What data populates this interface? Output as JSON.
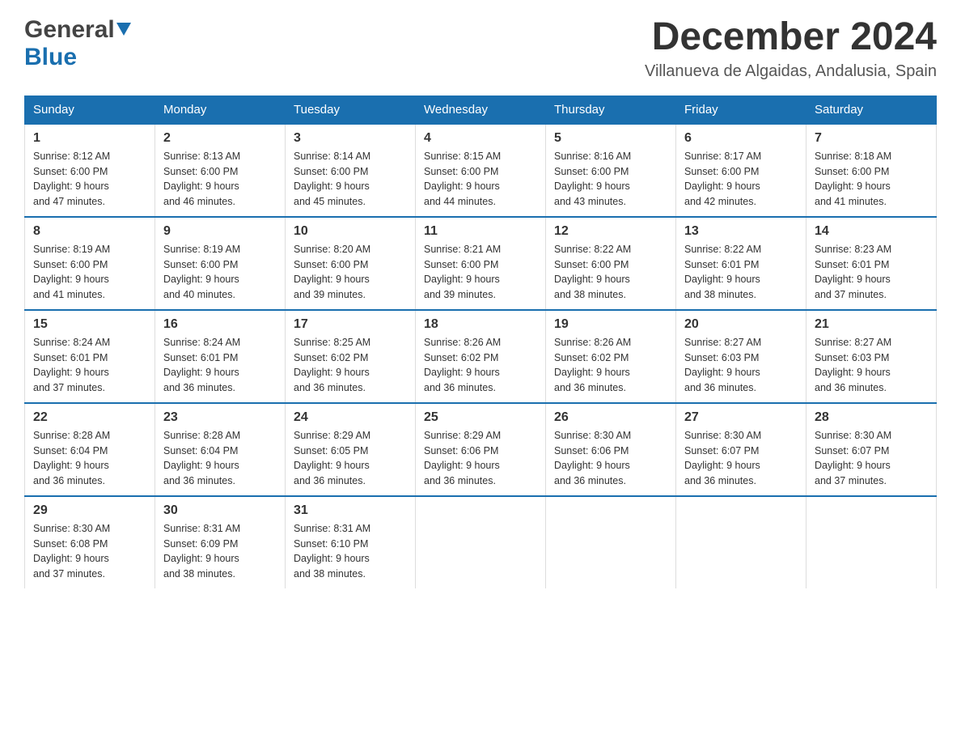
{
  "header": {
    "logo_general": "General",
    "logo_blue": "Blue",
    "month_title": "December 2024",
    "location": "Villanueva de Algaidas, Andalusia, Spain"
  },
  "days_of_week": [
    "Sunday",
    "Monday",
    "Tuesday",
    "Wednesday",
    "Thursday",
    "Friday",
    "Saturday"
  ],
  "weeks": [
    [
      {
        "day": "1",
        "sunrise": "8:12 AM",
        "sunset": "6:00 PM",
        "daylight": "9 hours and 47 minutes."
      },
      {
        "day": "2",
        "sunrise": "8:13 AM",
        "sunset": "6:00 PM",
        "daylight": "9 hours and 46 minutes."
      },
      {
        "day": "3",
        "sunrise": "8:14 AM",
        "sunset": "6:00 PM",
        "daylight": "9 hours and 45 minutes."
      },
      {
        "day": "4",
        "sunrise": "8:15 AM",
        "sunset": "6:00 PM",
        "daylight": "9 hours and 44 minutes."
      },
      {
        "day": "5",
        "sunrise": "8:16 AM",
        "sunset": "6:00 PM",
        "daylight": "9 hours and 43 minutes."
      },
      {
        "day": "6",
        "sunrise": "8:17 AM",
        "sunset": "6:00 PM",
        "daylight": "9 hours and 42 minutes."
      },
      {
        "day": "7",
        "sunrise": "8:18 AM",
        "sunset": "6:00 PM",
        "daylight": "9 hours and 41 minutes."
      }
    ],
    [
      {
        "day": "8",
        "sunrise": "8:19 AM",
        "sunset": "6:00 PM",
        "daylight": "9 hours and 41 minutes."
      },
      {
        "day": "9",
        "sunrise": "8:19 AM",
        "sunset": "6:00 PM",
        "daylight": "9 hours and 40 minutes."
      },
      {
        "day": "10",
        "sunrise": "8:20 AM",
        "sunset": "6:00 PM",
        "daylight": "9 hours and 39 minutes."
      },
      {
        "day": "11",
        "sunrise": "8:21 AM",
        "sunset": "6:00 PM",
        "daylight": "9 hours and 39 minutes."
      },
      {
        "day": "12",
        "sunrise": "8:22 AM",
        "sunset": "6:00 PM",
        "daylight": "9 hours and 38 minutes."
      },
      {
        "day": "13",
        "sunrise": "8:22 AM",
        "sunset": "6:01 PM",
        "daylight": "9 hours and 38 minutes."
      },
      {
        "day": "14",
        "sunrise": "8:23 AM",
        "sunset": "6:01 PM",
        "daylight": "9 hours and 37 minutes."
      }
    ],
    [
      {
        "day": "15",
        "sunrise": "8:24 AM",
        "sunset": "6:01 PM",
        "daylight": "9 hours and 37 minutes."
      },
      {
        "day": "16",
        "sunrise": "8:24 AM",
        "sunset": "6:01 PM",
        "daylight": "9 hours and 36 minutes."
      },
      {
        "day": "17",
        "sunrise": "8:25 AM",
        "sunset": "6:02 PM",
        "daylight": "9 hours and 36 minutes."
      },
      {
        "day": "18",
        "sunrise": "8:26 AM",
        "sunset": "6:02 PM",
        "daylight": "9 hours and 36 minutes."
      },
      {
        "day": "19",
        "sunrise": "8:26 AM",
        "sunset": "6:02 PM",
        "daylight": "9 hours and 36 minutes."
      },
      {
        "day": "20",
        "sunrise": "8:27 AM",
        "sunset": "6:03 PM",
        "daylight": "9 hours and 36 minutes."
      },
      {
        "day": "21",
        "sunrise": "8:27 AM",
        "sunset": "6:03 PM",
        "daylight": "9 hours and 36 minutes."
      }
    ],
    [
      {
        "day": "22",
        "sunrise": "8:28 AM",
        "sunset": "6:04 PM",
        "daylight": "9 hours and 36 minutes."
      },
      {
        "day": "23",
        "sunrise": "8:28 AM",
        "sunset": "6:04 PM",
        "daylight": "9 hours and 36 minutes."
      },
      {
        "day": "24",
        "sunrise": "8:29 AM",
        "sunset": "6:05 PM",
        "daylight": "9 hours and 36 minutes."
      },
      {
        "day": "25",
        "sunrise": "8:29 AM",
        "sunset": "6:06 PM",
        "daylight": "9 hours and 36 minutes."
      },
      {
        "day": "26",
        "sunrise": "8:30 AM",
        "sunset": "6:06 PM",
        "daylight": "9 hours and 36 minutes."
      },
      {
        "day": "27",
        "sunrise": "8:30 AM",
        "sunset": "6:07 PM",
        "daylight": "9 hours and 36 minutes."
      },
      {
        "day": "28",
        "sunrise": "8:30 AM",
        "sunset": "6:07 PM",
        "daylight": "9 hours and 37 minutes."
      }
    ],
    [
      {
        "day": "29",
        "sunrise": "8:30 AM",
        "sunset": "6:08 PM",
        "daylight": "9 hours and 37 minutes."
      },
      {
        "day": "30",
        "sunrise": "8:31 AM",
        "sunset": "6:09 PM",
        "daylight": "9 hours and 38 minutes."
      },
      {
        "day": "31",
        "sunrise": "8:31 AM",
        "sunset": "6:10 PM",
        "daylight": "9 hours and 38 minutes."
      },
      null,
      null,
      null,
      null
    ]
  ],
  "labels": {
    "sunrise": "Sunrise:",
    "sunset": "Sunset:",
    "daylight": "Daylight:"
  }
}
